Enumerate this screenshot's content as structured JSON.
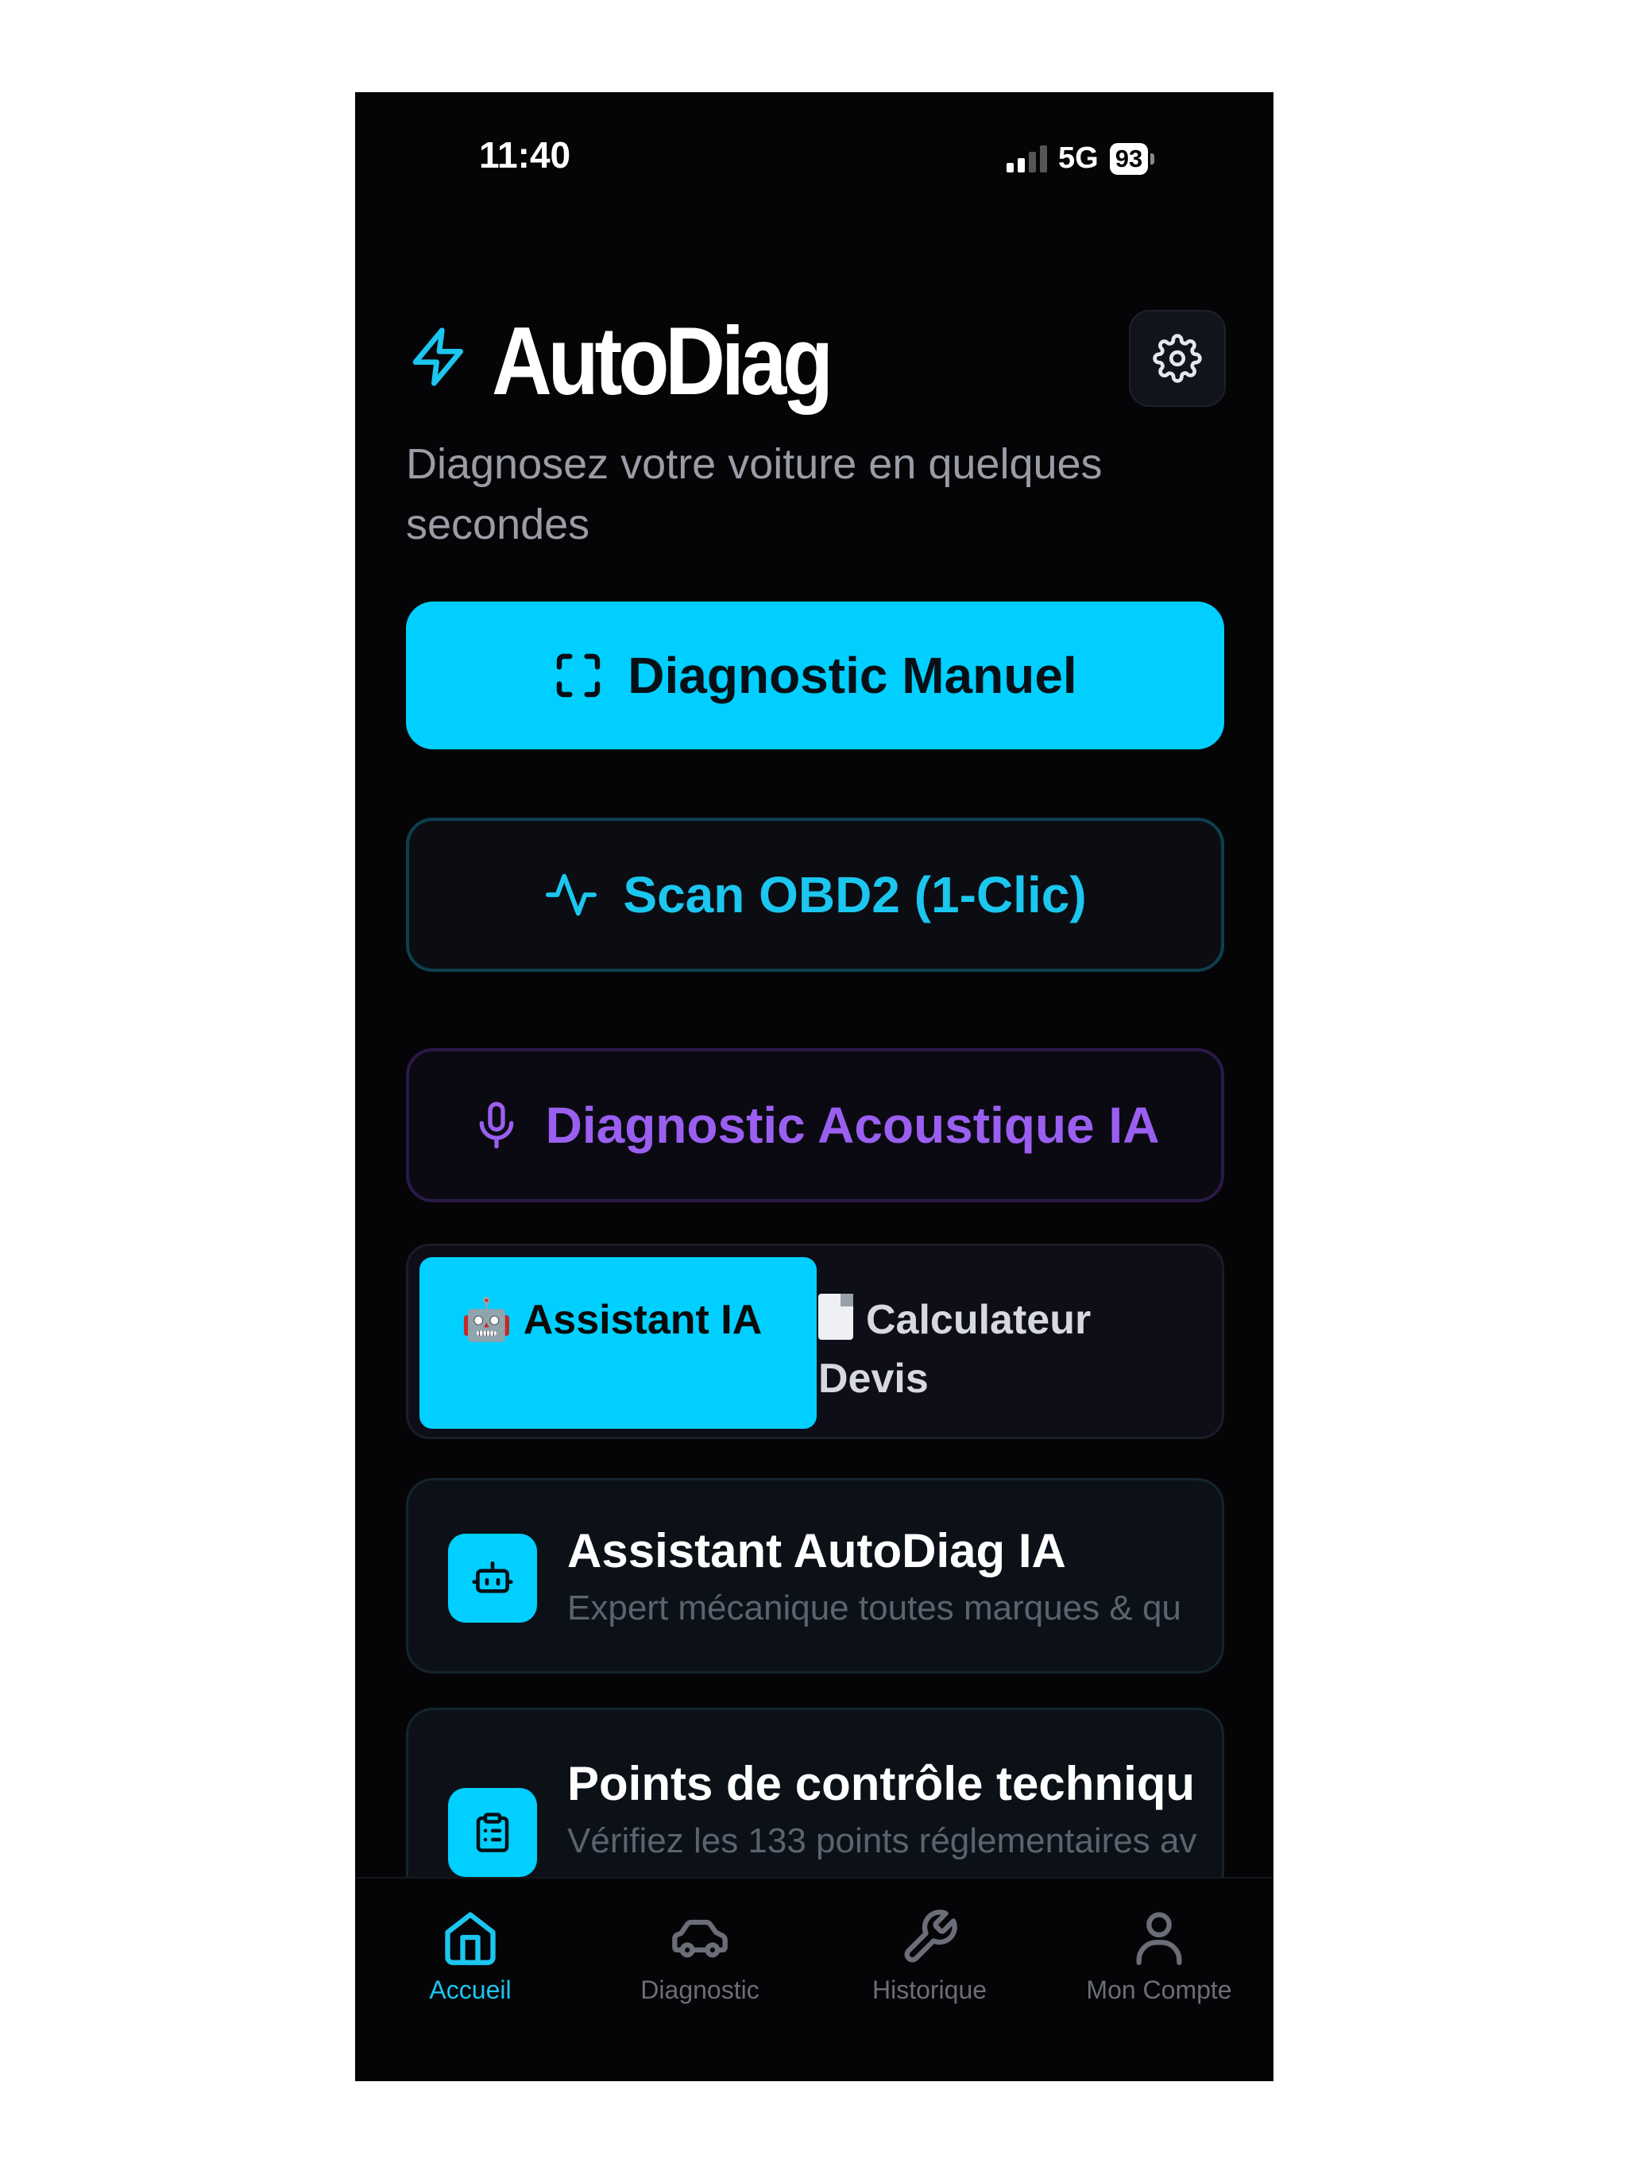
{
  "status": {
    "time": "11:40",
    "network": "5G",
    "battery": "93"
  },
  "header": {
    "title": "AutoDiag",
    "subtitle": "Diagnosez votre voiture en quelques secondes"
  },
  "actions": {
    "manuel": "Diagnostic Manuel",
    "obd": "Scan OBD2 (1-Clic)",
    "acoustique": "Diagnostic Acoustique IA"
  },
  "tabs": [
    {
      "emoji": "🤖",
      "label": "Assistant IA",
      "active": true
    },
    {
      "label": "Calculateur Devis",
      "active": false
    }
  ],
  "cards": [
    {
      "title": "Assistant AutoDiag IA",
      "subtitle": "Expert mécanique toutes marques & qu",
      "icon": "robot-icon"
    },
    {
      "title": "Points de contrôle techniqu",
      "subtitle": "Vérifiez les 133 points réglementaires av",
      "icon": "clipboard-list-icon"
    }
  ],
  "nav": [
    {
      "label": "Accueil",
      "icon": "home-icon",
      "active": true
    },
    {
      "label": "Diagnostic",
      "icon": "car-icon",
      "active": false
    },
    {
      "label": "Historique",
      "icon": "wrench-icon",
      "active": false
    },
    {
      "label": "Mon Compte",
      "icon": "user-icon",
      "active": false
    }
  ],
  "colors": {
    "accent": "#00cfff",
    "purple": "#9a5ff0",
    "background": "#050508"
  }
}
